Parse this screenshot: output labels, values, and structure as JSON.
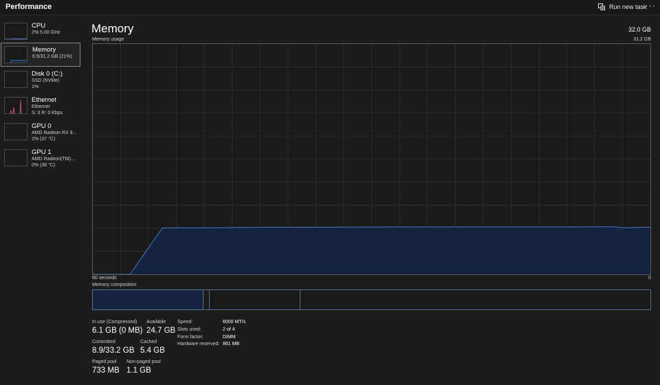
{
  "header": {
    "title": "Performance",
    "run_new_task": "Run new task",
    "more": "···"
  },
  "sidebar": {
    "items": [
      {
        "name": "CPU",
        "sub1": "2% 5.00 GHz",
        "sub2": ""
      },
      {
        "name": "Memory",
        "sub1": "6.5/31.2 GB (21%)",
        "sub2": ""
      },
      {
        "name": "Disk 0 (C:)",
        "sub1": "SSD (NVMe)",
        "sub2": "1%"
      },
      {
        "name": "Ethernet",
        "sub1": "Ethernet",
        "sub2": "S: 0 R: 0 Kbps"
      },
      {
        "name": "GPU 0",
        "sub1": "AMD Radeon RX 9...",
        "sub2": "2% (37 °C)"
      },
      {
        "name": "GPU 1",
        "sub1": "AMD Radeon(TM)...",
        "sub2": "0% (36 °C)"
      }
    ],
    "selected": "Memory"
  },
  "main": {
    "title": "Memory",
    "total": "32.0 GB",
    "usage_label": "Memory usage",
    "usage_max": "31.2 GB",
    "x_left": "60 seconds",
    "x_right": "0",
    "composition_label": "Memory composition"
  },
  "chart_data": {
    "type": "area",
    "title": "Memory usage",
    "xlabel": "",
    "ylabel": "",
    "x": [
      60,
      56,
      52.5,
      48,
      44,
      40,
      36,
      32,
      28,
      24,
      20,
      16,
      12,
      8,
      4,
      3,
      0
    ],
    "y": [
      0,
      0,
      6.3,
      6.3,
      6.35,
      6.38,
      6.38,
      6.4,
      6.42,
      6.42,
      6.42,
      6.43,
      6.43,
      6.43,
      6.45,
      6.3,
      6.4
    ],
    "x_range_seconds": [
      60,
      0
    ],
    "ylim": [
      0,
      31.2
    ],
    "unit": "GB",
    "grid": true,
    "fill_color": "#14233f",
    "line_color": "#4a79c6"
  },
  "composition": {
    "in_use_fraction": 0.197,
    "modified_fraction": 0.011,
    "standby_fraction": 0.163
  },
  "stats": {
    "in_use_label": "In use (Compressed)",
    "in_use_value": "6.1 GB (0 MB)",
    "available_label": "Available",
    "available_value": "24.7 GB",
    "committed_label": "Committed",
    "committed_value": "8.9/33.2 GB",
    "cached_label": "Cached",
    "cached_value": "5.4 GB",
    "paged_label": "Paged pool",
    "paged_value": "733 MB",
    "nonpaged_label": "Non-paged pool",
    "nonpaged_value": "1.1 GB"
  },
  "specs": {
    "speed_label": "Speed:",
    "speed_value": "6000 MT/s",
    "slots_label": "Slots used:",
    "slots_value": "2 of 4",
    "form_label": "Form factor:",
    "form_value": "DIMM",
    "hw_label": "Hardware reserved:",
    "hw_value": "861 MB"
  },
  "colors": {
    "accent": "#4a79c6",
    "fill": "#14233f",
    "background": "#1c1c1c"
  }
}
